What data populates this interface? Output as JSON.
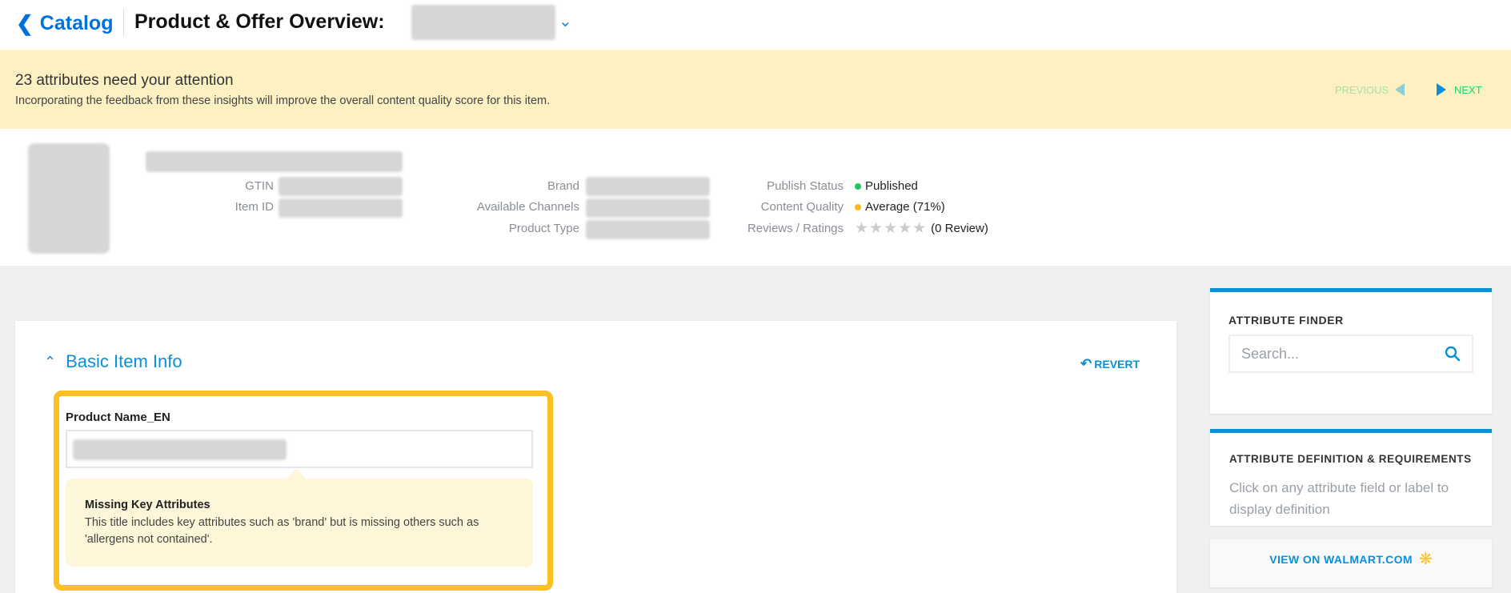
{
  "header": {
    "back_label": "Catalog",
    "title": "Product & Offer Overview:"
  },
  "banner": {
    "title": "23 attributes need your attention",
    "subtitle": "Incorporating the feedback from these insights will improve the overall content quality score for this item.",
    "previous_label": "PREVIOUS",
    "next_label": "NEXT"
  },
  "info": {
    "gtin_label": "GTIN",
    "item_id_label": "Item ID",
    "brand_label": "Brand",
    "channels_label": "Available Channels",
    "product_type_label": "Product Type",
    "publish_status_label": "Publish Status",
    "publish_status": "Published",
    "content_quality_label": "Content Quality",
    "content_quality": "Average (71%)",
    "reviews_label": "Reviews / Ratings",
    "reviews": "(0 Review)",
    "rating_stars": 0,
    "colors": {
      "published": "#1ec761",
      "average": "#fbb61a"
    }
  },
  "main": {
    "section_title": "Basic Item Info",
    "revert_label": "REVERT",
    "field_label": "Product Name_EN",
    "tip_title": "Missing Key Attributes",
    "tip_text": "This title includes key attributes such as 'brand' but is missing others such as 'allergens not contained'."
  },
  "sidebar": {
    "finder_title": "ATTRIBUTE FINDER",
    "search_placeholder": "Search...",
    "definition_title": "ATTRIBUTE DEFINITION & REQUIREMENTS",
    "definition_text": "Click on any attribute field or label to display definition",
    "view_label": "VIEW ON WALMART.COM"
  },
  "colors": {
    "accent": "#0a8fd9",
    "highlight": "#fdbf24"
  }
}
